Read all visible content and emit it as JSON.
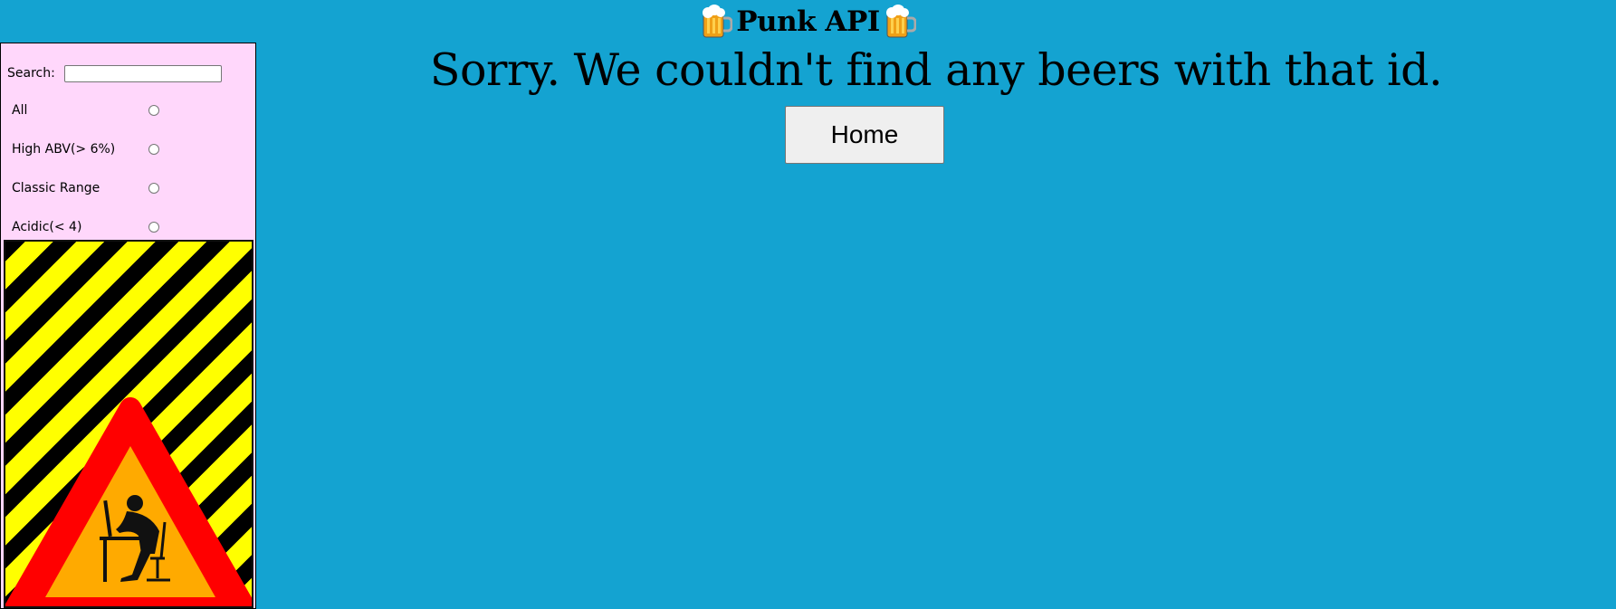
{
  "header": {
    "title": "Punk API",
    "left_icon": "beer-mug-icon",
    "right_icon": "beer-mug-icon"
  },
  "sidebar": {
    "search": {
      "label": "Search:",
      "value": "",
      "placeholder": ""
    },
    "filters": [
      {
        "label": "All",
        "selected": false
      },
      {
        "label": "High ABV(> 6%)",
        "selected": false
      },
      {
        "label": "Classic Range",
        "selected": false
      },
      {
        "label": "Acidic(< 4)",
        "selected": false
      }
    ],
    "image": {
      "icon": "under-construction-warning-icon",
      "colors": {
        "stripe_a": "#ffff00",
        "stripe_b": "#000000",
        "triangle": "#ff0000",
        "fill": "#ffaa00"
      }
    },
    "background": "#ffd7fb"
  },
  "main": {
    "message": "Sorry. We couldn't find any beers with that id.",
    "home_button": "Home"
  },
  "colors": {
    "page_background": "#14a3d1"
  }
}
